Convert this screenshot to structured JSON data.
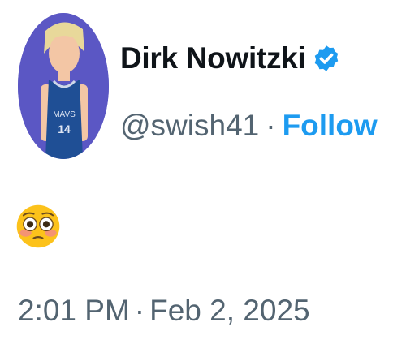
{
  "author": {
    "display_name": "Dirk Nowitzki",
    "handle": "@swish41",
    "verified": true,
    "jersey_number": "14",
    "avatar_bg_color": "#5b57c4"
  },
  "follow_label": "Follow",
  "separator": "·",
  "tweet_body": {
    "emoji": "flushed-face"
  },
  "meta": {
    "time": "2:01 PM",
    "date": "Feb 2, 2025"
  },
  "colors": {
    "accent": "#1d9bf0",
    "secondary_text": "#536471",
    "primary_text": "#0f1419"
  }
}
